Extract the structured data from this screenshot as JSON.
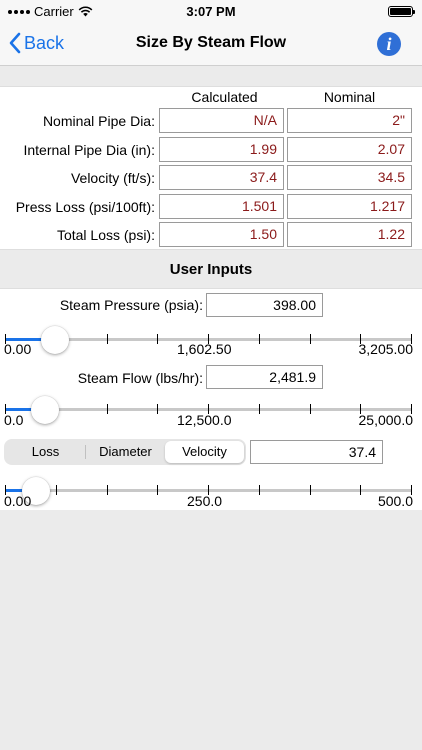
{
  "status": {
    "carrier": "Carrier",
    "time": "3:07 PM"
  },
  "nav": {
    "back_label": "Back",
    "title": "Size By Steam Flow",
    "info_icon": "info-icon"
  },
  "results": {
    "col_calculated": "Calculated",
    "col_nominal": "Nominal",
    "rows": [
      {
        "label": "Nominal Pipe Dia:",
        "calculated": "N/A",
        "nominal": "2\""
      },
      {
        "label": "Internal Pipe Dia (in):",
        "calculated": "1.99",
        "nominal": "2.07"
      },
      {
        "label": "Velocity (ft/s):",
        "calculated": "37.4",
        "nominal": "34.5"
      },
      {
        "label": "Press Loss (psi/100ft):",
        "calculated": "1.501",
        "nominal": "1.217"
      },
      {
        "label": "Total Loss (psi):",
        "calculated": "1.50",
        "nominal": "1.22"
      }
    ],
    "value_color": "#8b1a1a"
  },
  "user_inputs": {
    "title": "User Inputs",
    "pressure": {
      "label": "Steam Pressure (psia):",
      "value": "398.00",
      "min_label": "0.00",
      "mid_label": "1,602.50",
      "max_label": "3,205.00",
      "fraction": 0.124
    },
    "flow": {
      "label": "Steam Flow (lbs/hr):",
      "value": "2,481.9",
      "min_label": "0.0",
      "mid_label": "12,500.0",
      "max_label": "25,000.0",
      "fraction": 0.099
    },
    "mode": {
      "options": [
        "Loss",
        "Diameter",
        "Velocity"
      ],
      "selected": "Velocity",
      "value": "37.4"
    },
    "criteria": {
      "min_label": "0.00",
      "mid_label": "250.0",
      "max_label": "500.0",
      "fraction": 0.075
    }
  },
  "accent_color": "#1a73e8"
}
